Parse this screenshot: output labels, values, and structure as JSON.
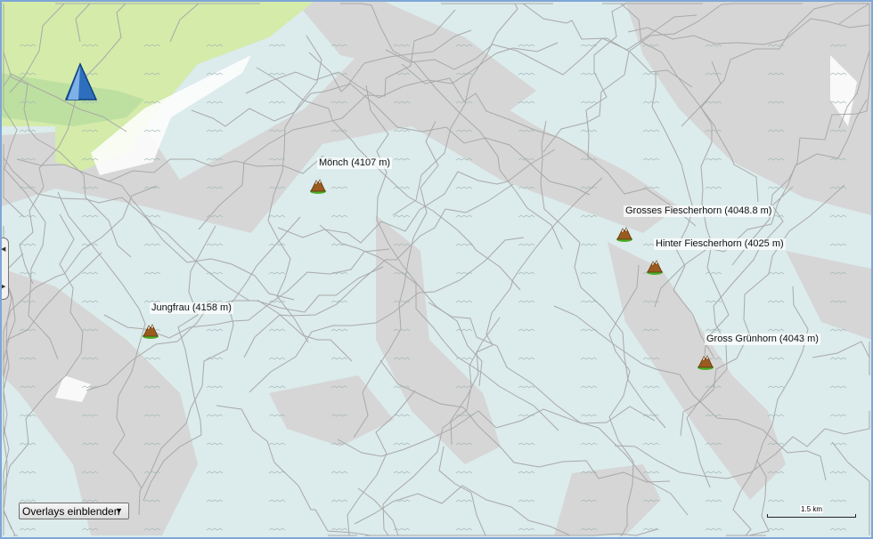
{
  "map": {
    "peaks": [
      {
        "name": "Mönch (4107 m)"
      },
      {
        "name": "Grosses Fiescherhorn (4048.8 m)"
      },
      {
        "name": "Hinter Fiescherhorn (4025 m)"
      },
      {
        "name": "Jungfrau (4158 m)"
      },
      {
        "name": "Gross Grünhorn (4043 m)"
      }
    ],
    "overlay_select": {
      "label": "Overlays einblenden"
    },
    "scale": {
      "label": "1.5 km"
    },
    "colors": {
      "glacier": "#dcebec",
      "rock": "#d6d6d6",
      "meadow": "#d4ebaa",
      "contour": "#a9a9a9"
    }
  }
}
